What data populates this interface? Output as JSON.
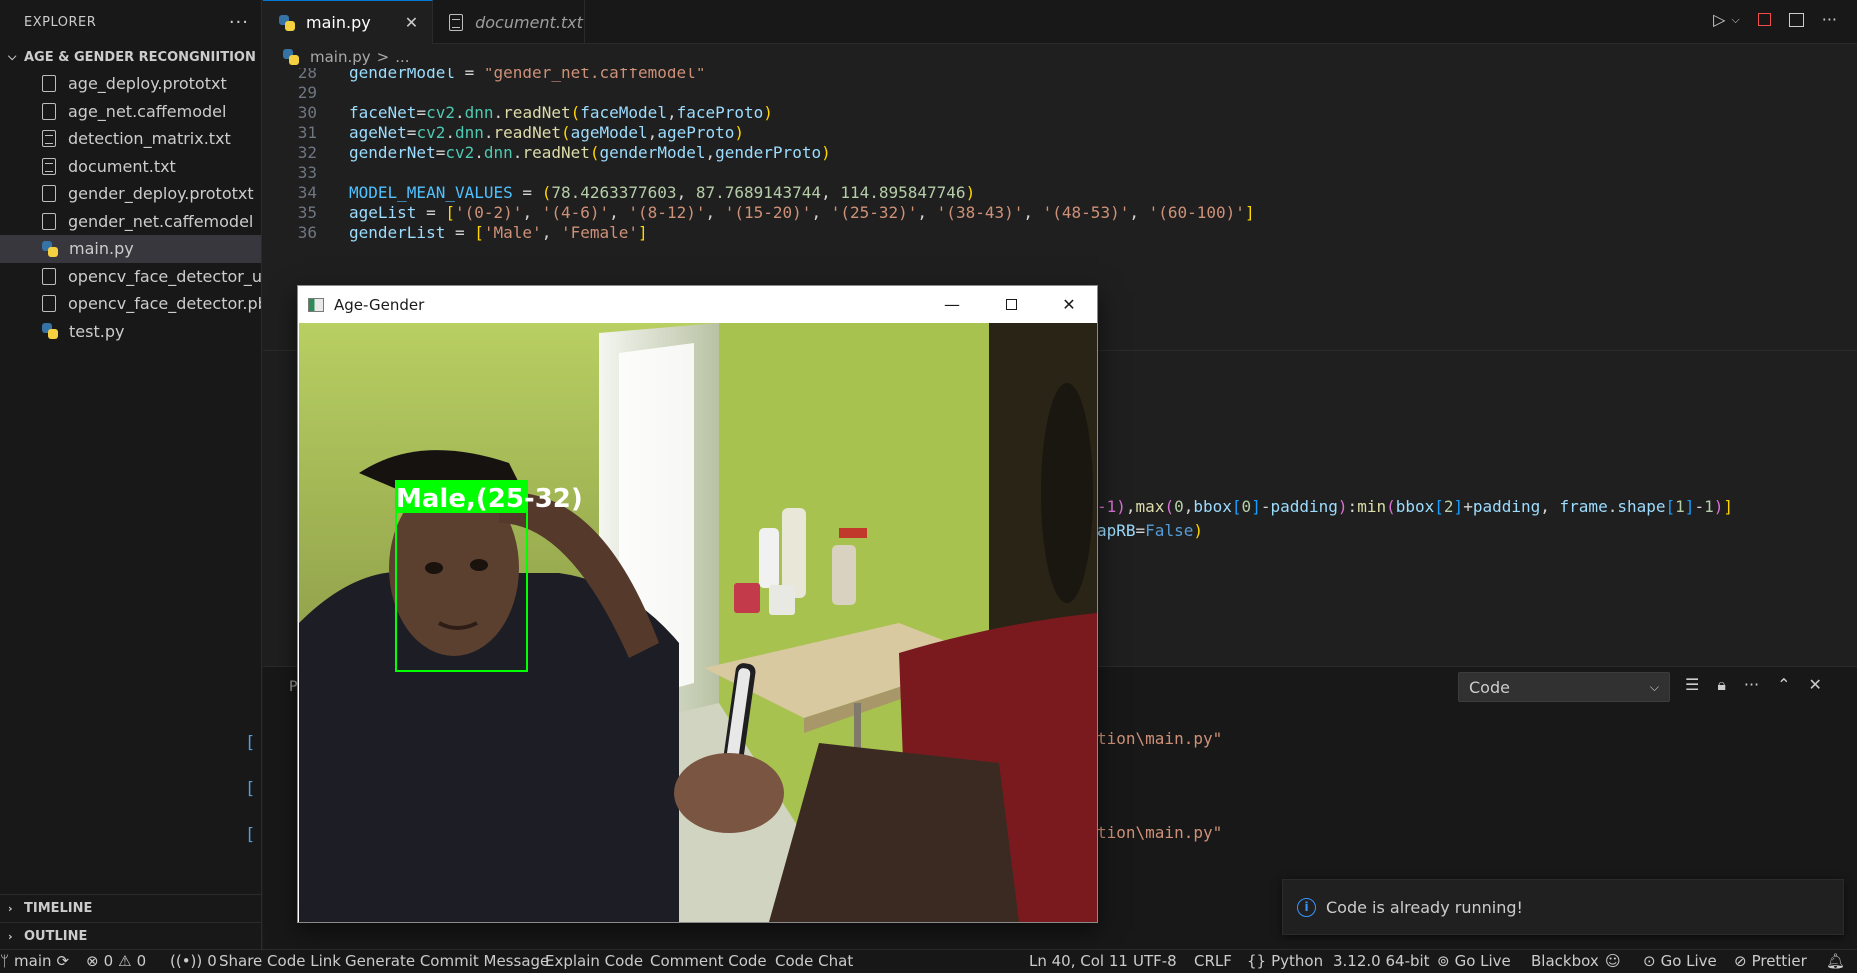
{
  "sidebar": {
    "title": "EXPLORER",
    "more": "···",
    "project": "AGE & GENDER RECONGNIITION",
    "files": [
      {
        "name": "age_deploy.prototxt",
        "icon": "file-icon"
      },
      {
        "name": "age_net.caffemodel",
        "icon": "file-icon"
      },
      {
        "name": "detection_matrix.txt",
        "icon": "text-file-icon"
      },
      {
        "name": "document.txt",
        "icon": "text-file-icon"
      },
      {
        "name": "gender_deploy.prototxt",
        "icon": "file-icon"
      },
      {
        "name": "gender_net.caffemodel",
        "icon": "file-icon"
      },
      {
        "name": "main.py",
        "icon": "python-icon",
        "active": true
      },
      {
        "name": "opencv_face_detector_ui...",
        "icon": "file-icon"
      },
      {
        "name": "opencv_face_detector.pb...",
        "icon": "file-icon"
      },
      {
        "name": "test.py",
        "icon": "python-icon"
      }
    ],
    "timeline": "TIMELINE",
    "outline": "OUTLINE"
  },
  "tabs": [
    {
      "label": "main.py",
      "close": "✕"
    },
    {
      "label": "document.txt"
    }
  ],
  "breadcrumb": {
    "file": "main.py",
    "sep": ">",
    "rest": "..."
  },
  "code": {
    "lines": [
      {
        "n": "28",
        "text": "genderModel = \"gender_net.caffemodel\""
      },
      {
        "n": "29",
        "text": ""
      },
      {
        "n": "30",
        "text": "faceNet=cv2.dnn.readNet(faceModel,faceProto)"
      },
      {
        "n": "31",
        "text": "ageNet=cv2.dnn.readNet(ageModel,ageProto)"
      },
      {
        "n": "32",
        "text": "genderNet=cv2.dnn.readNet(genderModel,genderProto)"
      },
      {
        "n": "33",
        "text": ""
      },
      {
        "n": "34",
        "text": "MODEL_MEAN_VALUES = (78.4263377603, 87.7689143744, 114.895847746)"
      },
      {
        "n": "35",
        "text": "ageList = ['(0-2)', '(4-6)', '(8-12)', '(15-20)', '(25-32)', '(38-43)', '(48-53)', '(60-100)']"
      },
      {
        "n": "36",
        "text": "genderList = ['Male', 'Female']"
      }
    ],
    "fragment1": "-1),max(0,bbox[0]-padding):min(bbox[2]+padding, frame.shape[1]-1)]",
    "fragment2": "apRB=False)"
  },
  "panel": {
    "tab_partial": "P",
    "select": "Code",
    "output_lines": [
      "tion\\main.py\"",
      "tion\\main.py\""
    ]
  },
  "notification": "Code is already running!",
  "cv_window": {
    "title": "Age-Gender",
    "label": "Male,(25-32)",
    "box_color": "#00ff00"
  },
  "statusbar": {
    "branch": "main",
    "errors": "0",
    "warnings": "0",
    "ports": "0",
    "items": [
      "Share Code Link",
      "Generate Commit Message",
      "Explain Code",
      "Comment Code",
      "Code Chat"
    ],
    "position": "Ln 40, Col 11",
    "encoding": "UTF-8",
    "eol": "CRLF",
    "language": "Python",
    "version": "3.12.0 64-bit",
    "golive1": "Go Live",
    "blackbox": "Blackbox",
    "golive2": "Go Live",
    "prettier": "Prettier"
  }
}
